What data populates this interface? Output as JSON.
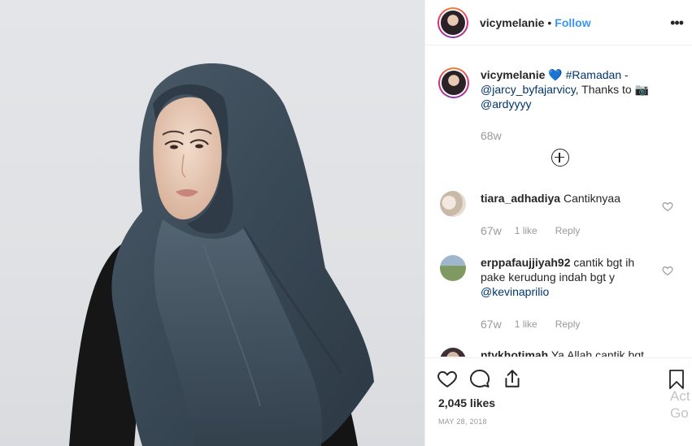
{
  "post": {
    "username": "vicymelanie",
    "dot": "•",
    "follow_label": "Follow",
    "more_icon": "more-horizontal-icon"
  },
  "caption": {
    "username": "vicymelanie",
    "heart_emoji": "💙",
    "hashtag": "#Ramadan",
    "dash": "-",
    "mention1": "@jarcy_byfajarvicy",
    "thanks": ", Thanks to",
    "camera_emoji": "📷",
    "mention2": "@ardyyyy",
    "time": "68w"
  },
  "load_more_icon": "plus-circle-icon",
  "comments": [
    {
      "username": "tiara_adhadiya",
      "text": "Cantiknyaa",
      "time": "67w",
      "likes": "1 like",
      "reply": "Reply"
    },
    {
      "username": "erppafaujjiyah92",
      "text": "cantik bgt ih pake kerudung indah bgt y",
      "mention": "@kevinaprilio",
      "time": "67w",
      "likes": "1 like",
      "reply": "Reply"
    },
    {
      "username": "ntvkhotimah",
      "text": "Ya Allah cantik bgt"
    }
  ],
  "actions": {
    "like_icon": "heart-icon",
    "comment_icon": "comment-icon",
    "share_icon": "share-icon",
    "save_icon": "bookmark-icon",
    "likes": "2,045 likes",
    "date": "MAY 28, 2018"
  },
  "watermark": {
    "line1": "Act",
    "line2": "Go t"
  },
  "colors": {
    "link": "#003569",
    "follow": "#3897f0",
    "hijab": "#3b4a58",
    "muted": "#999999"
  }
}
